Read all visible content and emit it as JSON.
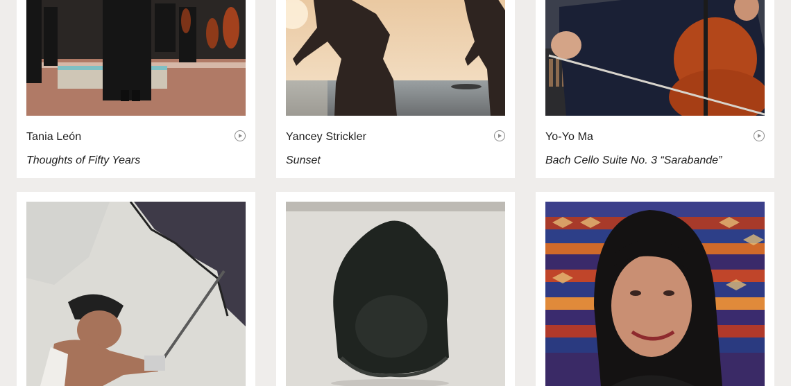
{
  "cards": [
    {
      "artist": "Tania León",
      "title": "Thoughts of Fifty Years",
      "image": "orchestra-photo"
    },
    {
      "artist": "Yancey Strickler",
      "title": "Sunset",
      "image": "beach-sunset-photo"
    },
    {
      "artist": "Yo-Yo Ma",
      "title": "Bach Cello Suite No. 3 “Sarabande”",
      "image": "cellist-photo"
    },
    {
      "artist": "",
      "title": "",
      "image": "mural-painter-photo"
    },
    {
      "artist": "",
      "title": "",
      "image": "hooded-sculpture-photo"
    },
    {
      "artist": "",
      "title": "",
      "image": "poet-portrait-photo"
    }
  ],
  "icons": {
    "play": "play-circle-icon"
  },
  "colors": {
    "background": "#efedeb",
    "card": "#ffffff",
    "icon": "#8a8a8a"
  }
}
